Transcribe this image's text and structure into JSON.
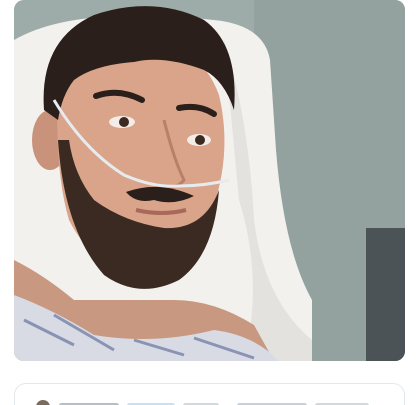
{
  "post": {
    "media": {
      "kind": "photo",
      "icon": "photo-icon",
      "accent_color": "#9eaca9"
    }
  },
  "colors": {
    "wall": "#9eaca9",
    "pillow": "#f3f1ee",
    "skin": "#d9a48a",
    "beard": "#3a2a22",
    "gown": "#d8dbe3",
    "card_border": "#e1e8ed"
  },
  "reply_card": {
    "avatar_icon": "avatar-icon"
  }
}
